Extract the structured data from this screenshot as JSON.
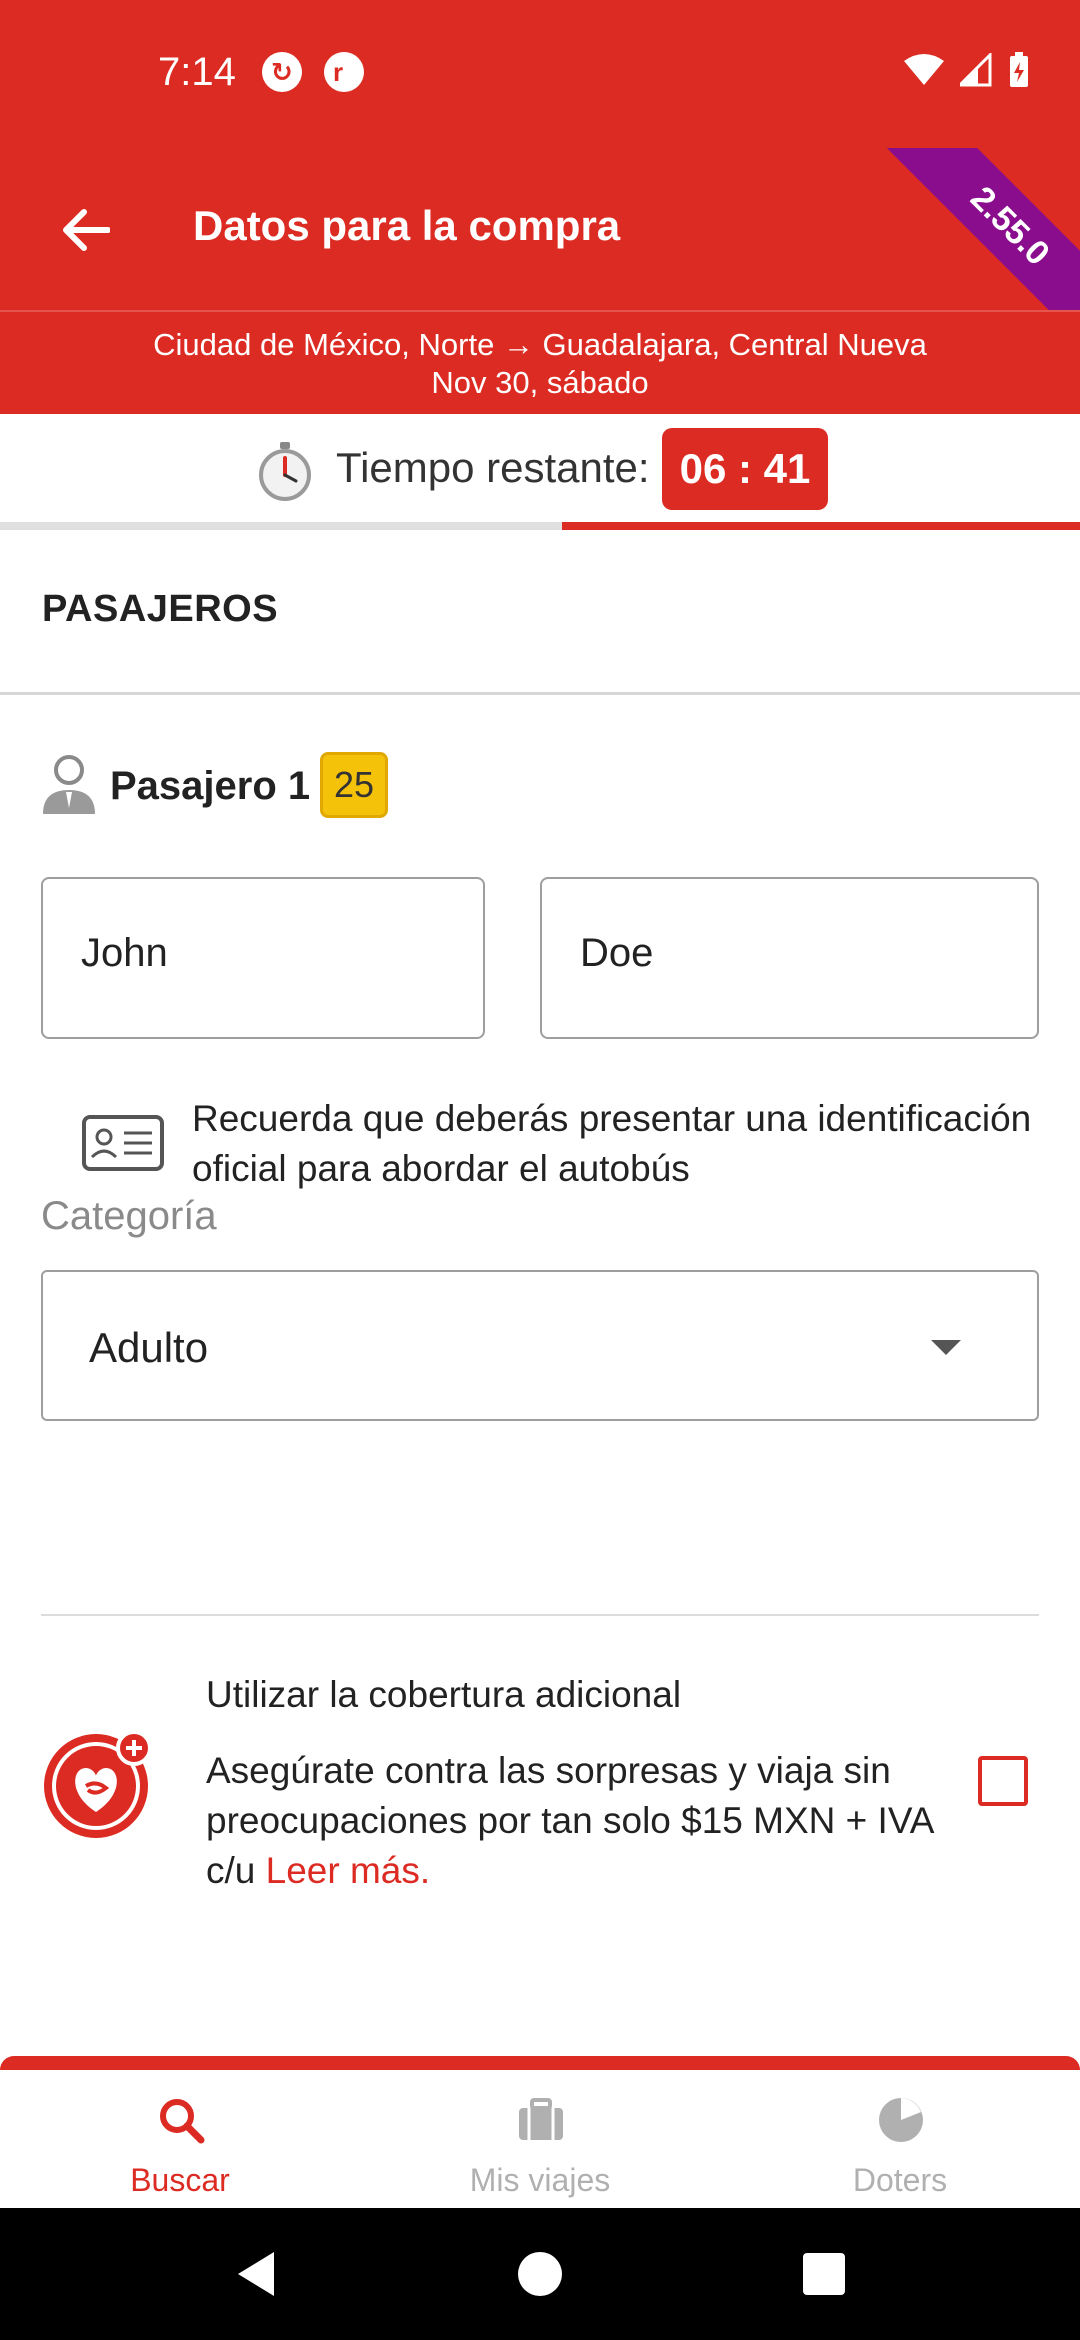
{
  "status_bar": {
    "time": "7:14"
  },
  "app_bar": {
    "title": "Datos para la compra",
    "version": "2.55.0"
  },
  "route": {
    "line": "Ciudad de México, Norte → Guadalajara, Central Nueva",
    "date": "Nov 30, sábado"
  },
  "timer": {
    "label": "Tiempo restante:",
    "value": "06 : 41",
    "progress_remaining": 0.48
  },
  "section": {
    "title": "PASAJEROS"
  },
  "passenger": {
    "label": "Pasajero 1",
    "seat": "25",
    "first_name": "John",
    "last_name": "Doe",
    "id_note": "Recuerda que deberás presentar una identificación oficial para abordar el autobús"
  },
  "category": {
    "label": "Categoría",
    "selected": "Adulto"
  },
  "coverage": {
    "title": "Utilizar la cobertura adicional",
    "description": "Asegúrate contra las sorpresas y viaja sin preocupaciones por tan solo $15 MXN + IVA c/u",
    "link": "Leer más.",
    "checked": false
  },
  "bottom_nav": {
    "items": [
      {
        "label": "Buscar",
        "icon": "search-icon",
        "active": true
      },
      {
        "label": "Mis viajes",
        "icon": "briefcase-icon",
        "active": false
      },
      {
        "label": "Doters",
        "icon": "doters-icon",
        "active": false
      }
    ]
  },
  "colors": {
    "brand_red": "#dc2b22",
    "ribbon_purple": "#8a0d8e",
    "seat_yellow": "#f5c20a"
  }
}
